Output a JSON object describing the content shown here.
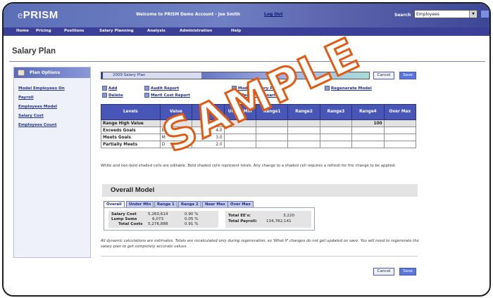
{
  "app": {
    "logo_prefix": "e",
    "logo_name": "PRISM",
    "welcome": "Welcome to PRISM Demo Account - Joe Smith",
    "logout": "Log Out",
    "search_label": "Search",
    "search_value": "Employees"
  },
  "nav": [
    "Home",
    "Pricing",
    "Positions",
    "Salary Planning",
    "Analysis",
    "Administration",
    "Help"
  ],
  "page": {
    "title": "Salary Plan"
  },
  "sidebar": {
    "header": "Plan Options",
    "items": [
      "Model Employees On",
      "Payroll",
      "Employees Model",
      "Salary Cost",
      "Employees Count"
    ]
  },
  "plan": {
    "name": "2009 Salary Plan",
    "cancel": "Cancel",
    "save": "Save"
  },
  "actions": {
    "add": "Add",
    "delete": "Delete",
    "audit_report": "Audit Report",
    "merit_cost_report": "Merit Cost Report",
    "modify_salary_plan": "Modify Salary Plan",
    "effect_of_scenarios": "Effect Of Scenarios",
    "regenerate_model": "Regenerate Model"
  },
  "table": {
    "headers": [
      "Levels",
      "Value",
      "Eff %",
      "Under Min",
      "Range1",
      "Range2",
      "Range3",
      "Range4",
      "Over Max"
    ],
    "rows": [
      [
        "Range High Value",
        "",
        "",
        "",
        "",
        "",
        "",
        "100",
        ""
      ],
      [
        "Exceeds Goals",
        "E",
        "4.0",
        "",
        "",
        "",
        "",
        "",
        ""
      ],
      [
        "Meets Goals",
        "M",
        "3.0",
        "",
        "",
        "",
        "",
        "",
        ""
      ],
      [
        "Partially Meets",
        "D",
        "2.0",
        "",
        "",
        "",
        "",
        "",
        ""
      ]
    ]
  },
  "note": "White and non-bold shaded cells are editable. Bold shaded cells represent totals. Any change to a shaded cell requires a refresh for the change to be applied.",
  "overall": {
    "title": "Overall Model",
    "tabs": [
      "Overall",
      "Under Min",
      "Range 1",
      "Range 2",
      "Near Max",
      "Over Max"
    ],
    "stats": [
      {
        "label": "Salary Cost",
        "value": "5,260,614",
        "pct": "0.90 %"
      },
      {
        "label": "Lump Sums",
        "value": "6,073",
        "pct": "0.05 %"
      },
      {
        "label": "Total Costs",
        "value": "5,276,888",
        "pct": "0.91 %"
      }
    ],
    "totals": [
      {
        "label": "Total EE's:",
        "value": "3,220"
      },
      {
        "label": "Total Payroll:",
        "value": "134,782,141"
      }
    ]
  },
  "footnote": "All dynamic calculations are estimates. Totals are recalculated only during regeneration, so 'What If' changes do not get updated on save. You will need to regenerate the salary plan to get completely accurate values.",
  "watermark": "SAMPLE"
}
